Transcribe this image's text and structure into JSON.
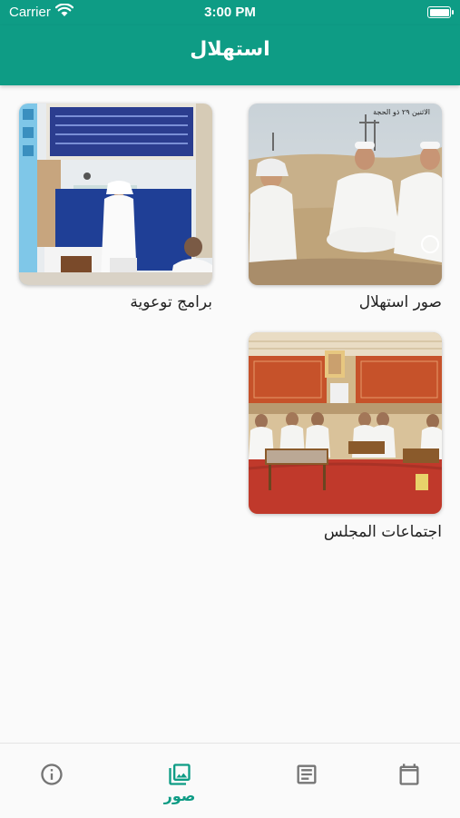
{
  "status_bar": {
    "carrier": "Carrier",
    "time": "3:00 PM"
  },
  "header": {
    "title": "استهلال"
  },
  "albums": [
    {
      "label": "صور استهلال",
      "photo_caption": "الاثنين ٢٩ ذو الحجة"
    },
    {
      "label": "برامج توعوية"
    },
    {
      "label": "اجتماعات المجلس"
    }
  ],
  "tabs": [
    {
      "icon": "calendar-icon",
      "label": "",
      "active": false
    },
    {
      "icon": "article-icon",
      "label": "",
      "active": false
    },
    {
      "icon": "photo-library-icon",
      "label": "صور",
      "active": true
    },
    {
      "icon": "info-icon",
      "label": "",
      "active": false
    }
  ],
  "colors": {
    "primary": "#0e9c85",
    "inactive_icon": "#757575",
    "background": "#fafafa"
  }
}
